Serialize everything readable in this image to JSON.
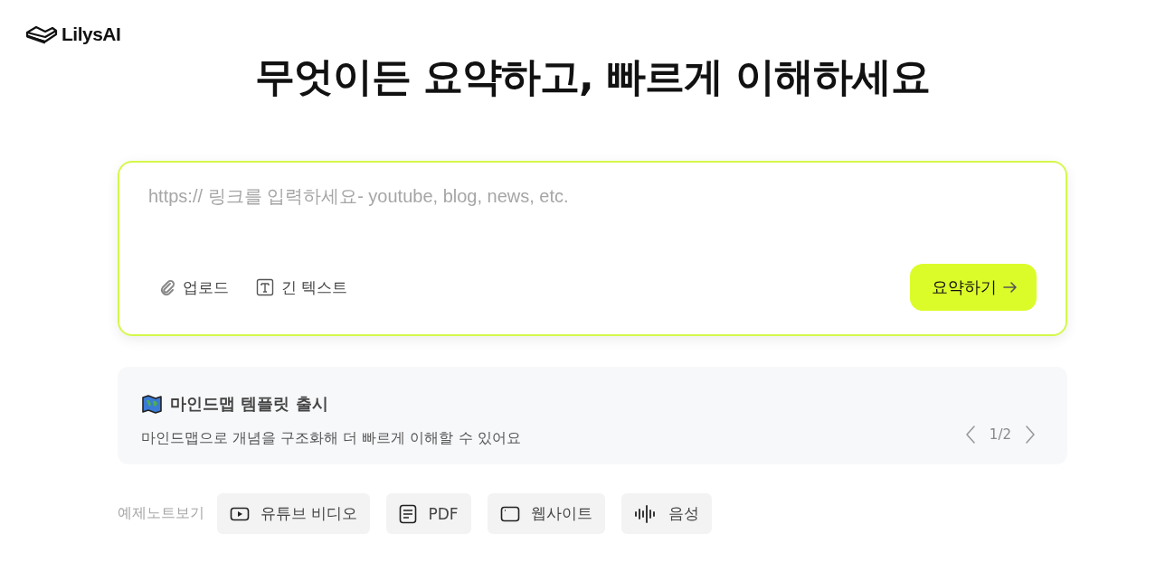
{
  "logo": {
    "text": "LilysAI"
  },
  "headline": "무엇이든 요약하고, 빠르게 이해하세요",
  "link_input": {
    "placeholder": "https:// 링크를 입력하세요- youtube, blog, news, etc."
  },
  "input_actions": [
    {
      "kind": "upload",
      "label": "업로드"
    },
    {
      "kind": "text",
      "label": "긴 텍스트"
    }
  ],
  "submit_button": {
    "label": "요약하기"
  },
  "notice": {
    "title": "마인드맵 템플릿 출시",
    "description": "마인드맵으로 개념을 구조화해 더 빠르게 이해할 수 있어요",
    "pager": "1/2"
  },
  "examples": {
    "label": "예제노트보기",
    "chips": [
      {
        "kind": "video",
        "label": "유튜브 비디오"
      },
      {
        "kind": "pdf",
        "label": "PDF"
      },
      {
        "kind": "website",
        "label": "웹사이트"
      },
      {
        "kind": "audio",
        "label": "음성"
      }
    ]
  }
}
